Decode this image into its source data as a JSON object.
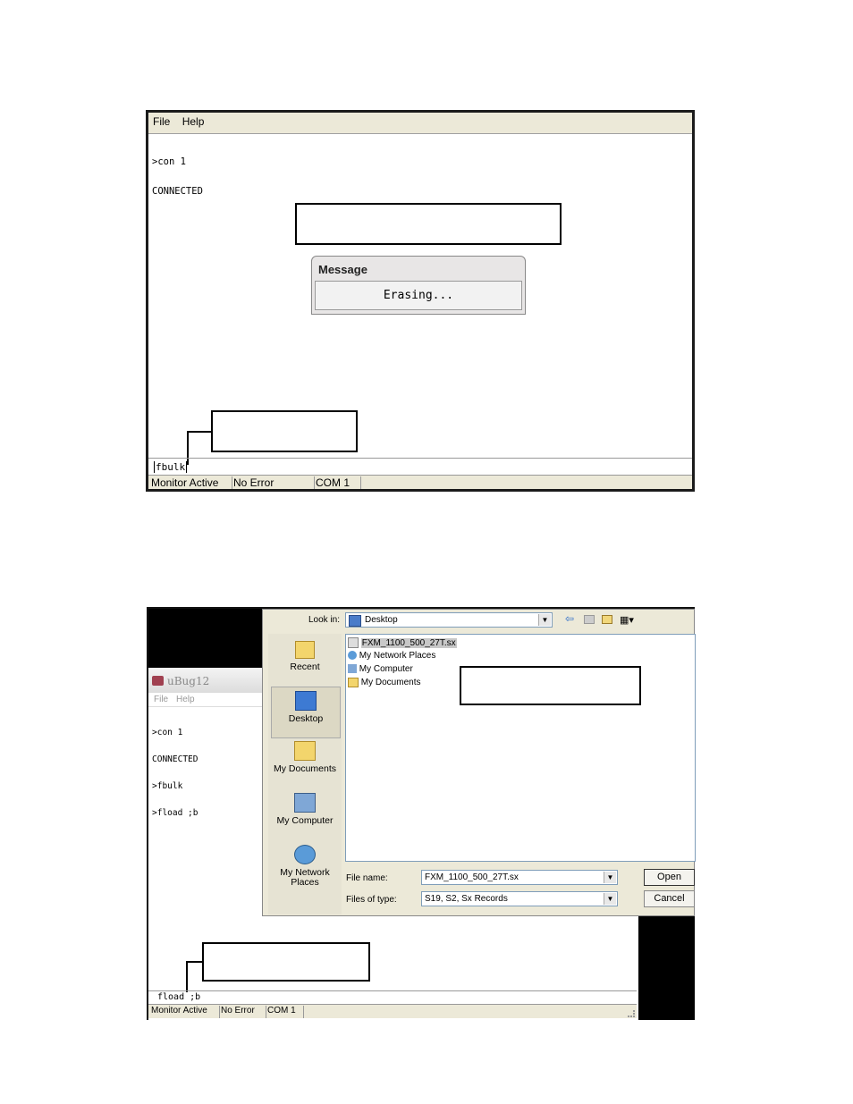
{
  "top_window": {
    "menu": [
      "File",
      "Help"
    ],
    "console_lines": [
      ">con 1",
      "CONNECTED"
    ],
    "message_dialog": {
      "title": "Message",
      "text": "Erasing..."
    },
    "command": "fbulk",
    "status": [
      "Monitor Active",
      "No Error",
      "COM 1"
    ]
  },
  "bottom_window": {
    "app_title": "uBug12",
    "menu": [
      "File",
      "Help"
    ],
    "console_lines": [
      ">con 1",
      "CONNECTED",
      ">fbulk",
      ">fload ;b"
    ],
    "command": "fload ;b",
    "status": [
      "Monitor Active",
      "No Error",
      "COM 1"
    ],
    "open_dialog": {
      "look_in_label": "Look in:",
      "look_in_value": "Desktop",
      "places": [
        "Recent",
        "Desktop",
        "My Documents",
        "My Computer",
        "My Network Places"
      ],
      "files": [
        "FXM_1100_500_27T.sx",
        "My Network Places",
        "My Computer",
        "My Documents"
      ],
      "file_name_label": "File name:",
      "file_name_value": "FXM_1100_500_27T.sx",
      "files_of_type_label": "Files of type:",
      "files_of_type_value": "S19, S2, Sx Records",
      "open_button": "Open",
      "cancel_button": "Cancel"
    }
  }
}
